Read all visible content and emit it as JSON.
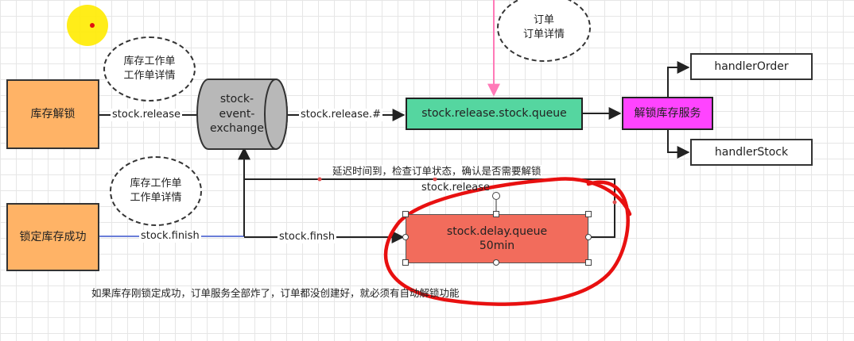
{
  "nodes": {
    "stock_unlock": "库存解锁",
    "lock_success": "锁定库存成功",
    "exchange": "stock-\nevent-\nexchange",
    "release_queue": "stock.release.stock.queue",
    "unlock_service": "解锁库存服务",
    "handler_order": "handlerOrder",
    "handler_stock": "handlerStock",
    "delay_queue": "stock.delay.queue\n50min"
  },
  "ellipses": {
    "order": "订单\n订单详情",
    "stock_top": "库存工作单\n工作单详情",
    "stock_bottom": "库存工作单\n工作单详情"
  },
  "edges": {
    "stock_release": "stock.release",
    "stock_release_hash": "stock.release.#",
    "stock_finish": "stock.finish",
    "stock_finsh": "stock.finsh",
    "delay_release": "stock.release"
  },
  "notes": {
    "delay_note": "延迟时间到，检查订单状态，确认是否需要解锁",
    "bottom_note": "如果库存刚锁定成功，订单服务全部炸了，订单都没创建好，就必须有自动解锁功能"
  },
  "colors": {
    "orange": "#ffb366",
    "green": "#55d6a0",
    "magenta": "#ff44ff",
    "delay": "#f26c5c",
    "pink_arrow": "#ff7ab8",
    "red_annotation": "#e81010",
    "highlight": "#ffeb00"
  }
}
